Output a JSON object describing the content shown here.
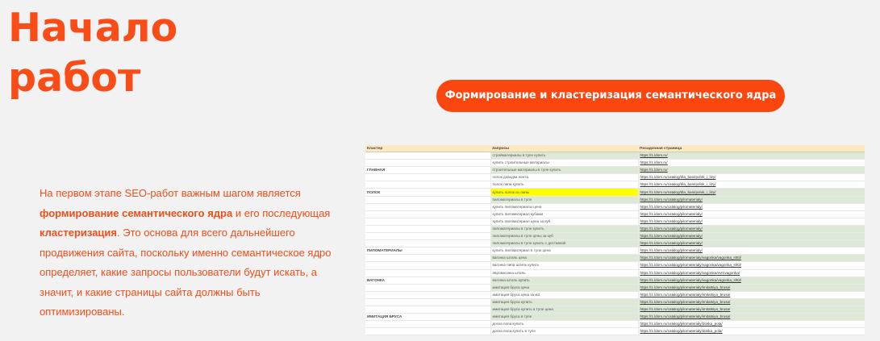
{
  "heading": {
    "line1": "Начало",
    "line2": "работ"
  },
  "cta_button": {
    "label": "Формирование и кластеризация семантического ядра"
  },
  "description": {
    "part1": "На первом этапе SEO-работ важным шагом является ",
    "bold1": "формирование семантического ядра",
    "part2": " и его последующая ",
    "bold2": "кластеризация",
    "part3": ". Это основа для всего дальнейшего продвижения сайта, поскольку именно семантическое ядро определяет, какие запросы пользователи будут искать, а значит, и какие страницы сайта должны быть оптимизированы."
  },
  "sheet": {
    "headers": [
      "Кластер",
      "Запросы",
      "Посадочная страница"
    ],
    "rows": [
      {
        "cluster": "",
        "query": "стройматериалы в туле купить",
        "url": "https://1.ldom.ru/",
        "hl": "g"
      },
      {
        "cluster": "",
        "query": "купить строительные материалы",
        "url": "https://1.ldom.ru/",
        "hl": ""
      },
      {
        "cluster": "ГЛАВНАЯ",
        "query": "строительные материалы в туле купить",
        "url": "https://1.ldom.ru/",
        "hl": "g"
      },
      {
        "cluster": "",
        "query": "полок доводки лента",
        "url": "https://1.ldom.ru/catalog/dla_bani/polok_i_lizy/",
        "hl": ""
      },
      {
        "cluster": "",
        "query": "полок липа купить",
        "url": "https://1.ldom.ru/catalog/dla_bani/polok_i_lizy/",
        "hl": ""
      },
      {
        "cluster": "ПОЛОК",
        "query": "купить полок из липы",
        "url": "https://1.ldom.ru/catalog/dla_bani/polok_i_lizy/",
        "hl": "y"
      },
      {
        "cluster": "",
        "query": "пиломатериалы в туле",
        "url": "https://1.ldom.ru/catalog/pilomaterialy/",
        "hl": "g"
      },
      {
        "cluster": "",
        "query": "купить пиломатериалы цена",
        "url": "https://1.ldom.ru/catalog/pilomaterialy/",
        "hl": ""
      },
      {
        "cluster": "",
        "query": "купить пиломатериал кубами",
        "url": "https://1.ldom.ru/catalog/pilomaterialy/",
        "hl": ""
      },
      {
        "cluster": "",
        "query": "купить пиломатериал цена за куб",
        "url": "https://1.ldom.ru/catalog/pilomaterialy/",
        "hl": ""
      },
      {
        "cluster": "",
        "query": "пиломатериалы в туле купить",
        "url": "https://1.ldom.ru/catalog/pilomaterialy/",
        "hl": "g"
      },
      {
        "cluster": "",
        "query": "пиломатериалы в туле цены за куб",
        "url": "https://1.ldom.ru/catalog/pilomaterialy/",
        "hl": "g"
      },
      {
        "cluster": "",
        "query": "пиломатериалы в туле купить с доставкой",
        "url": "https://1.ldom.ru/catalog/pilomaterialy/",
        "hl": "g"
      },
      {
        "cluster": "ПИЛОМАТЕРИАЛЫ",
        "query": "купить пиломатериал в туле цена",
        "url": "https://1.ldom.ru/catalog/pilomaterialy/",
        "hl": ""
      },
      {
        "cluster": "",
        "query": "вагонка штиль цена",
        "url": "https://1.ldom.ru/catalog/pilomaterialy/vagonka/vagonka_shtil/",
        "hl": "g"
      },
      {
        "cluster": "",
        "query": "вагонка липа штиль купить",
        "url": "https://1.ldom.ru/catalog/pilomaterialy/vagonka/vagonka_shtil/",
        "hl": ""
      },
      {
        "cluster": "",
        "query": "евровагонка штиль",
        "url": "https://1.ldom.ru/catalog/pilomaterialy/vagonka/evrovagonka/",
        "hl": ""
      },
      {
        "cluster": "ВАГОНКА",
        "query": "вагонка штиль купить",
        "url": "https://1.ldom.ru/catalog/pilomaterialy/vagonka/vagonka_shtil/",
        "hl": "g"
      },
      {
        "cluster": "",
        "query": "имитация бруса цена",
        "url": "https://1.ldom.ru/catalog/pilomaterialy/imitatsiya_brusa/",
        "hl": "g"
      },
      {
        "cluster": "",
        "query": "имитация бруса цена за м2",
        "url": "https://1.ldom.ru/catalog/pilomaterialy/imitatsiya_brusa/",
        "hl": ""
      },
      {
        "cluster": "",
        "query": "имитация бруса купить",
        "url": "https://1.ldom.ru/catalog/pilomaterialy/imitatsiya_brusa/",
        "hl": "g"
      },
      {
        "cluster": "",
        "query": "имитация бруса купить в туле цена",
        "url": "https://1.ldom.ru/catalog/pilomaterialy/imitatsiya_brusa/",
        "hl": "g"
      },
      {
        "cluster": "ИМИТАЦИЯ БРУСА",
        "query": "имитация бруса в туле",
        "url": "https://1.ldom.ru/catalog/pilomaterialy/imitatsiya_brusa/",
        "hl": "g"
      },
      {
        "cluster": "",
        "query": "доска пола купить",
        "url": "https://1.ldom.ru/catalog/pilomaterialy/doska_pola/",
        "hl": ""
      },
      {
        "cluster": "",
        "query": "доска пола купить в туле",
        "url": "https://1.ldom.ru/catalog/pilomaterialy/doska_pola/",
        "hl": ""
      }
    ]
  },
  "colors": {
    "accent": "#fa4c16",
    "button_bg": "#fa4710",
    "background": "#f2f2f2",
    "sheet_header": "#fbe9c3",
    "sheet_green": "#dde9d6",
    "sheet_yellow": "#ffff00"
  }
}
